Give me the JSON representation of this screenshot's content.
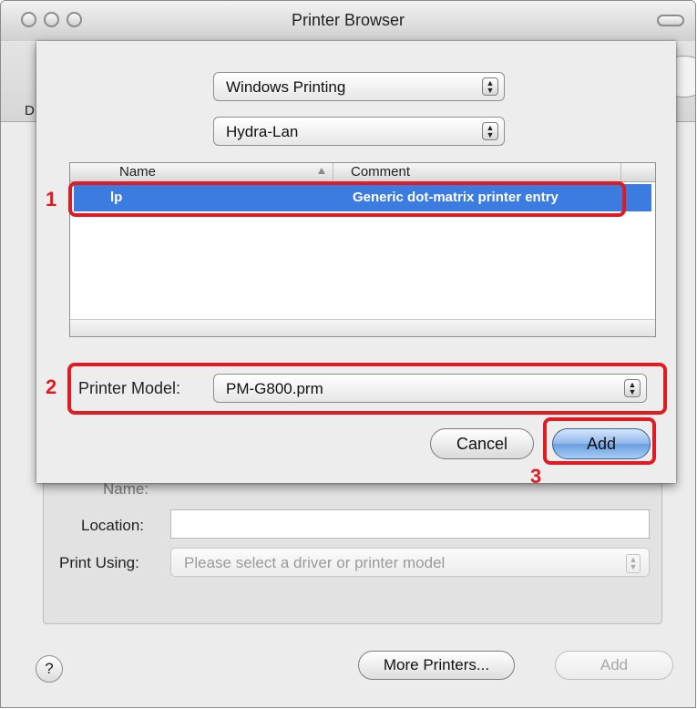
{
  "window": {
    "title": "Printer Browser",
    "toolbar_clipped_label": "D"
  },
  "back_form": {
    "name_label": "Name:",
    "location_label": "Location:",
    "location_value": "",
    "print_using_label": "Print Using:",
    "print_using_placeholder": "Please select a driver or printer model"
  },
  "footer": {
    "help_label": "?",
    "more_printers_label": "More Printers...",
    "add_label": "Add"
  },
  "sheet": {
    "connection_popup": "Windows Printing",
    "workgroup_popup": "Hydra-Lan",
    "table": {
      "columns": [
        "Name",
        "Comment"
      ],
      "sort_column": "Name",
      "rows": [
        {
          "name": "lp",
          "comment": "Generic dot-matrix printer entry",
          "selected": true
        }
      ]
    },
    "printer_model_label": "Printer Model:",
    "printer_model_value": "PM-G800.prm",
    "cancel_label": "Cancel",
    "add_label": "Add"
  },
  "annotations": [
    "1",
    "2",
    "3"
  ],
  "colors": {
    "selection": "#3c7be0",
    "annotation": "#e11b22",
    "default_button": "#8fb7ea"
  }
}
